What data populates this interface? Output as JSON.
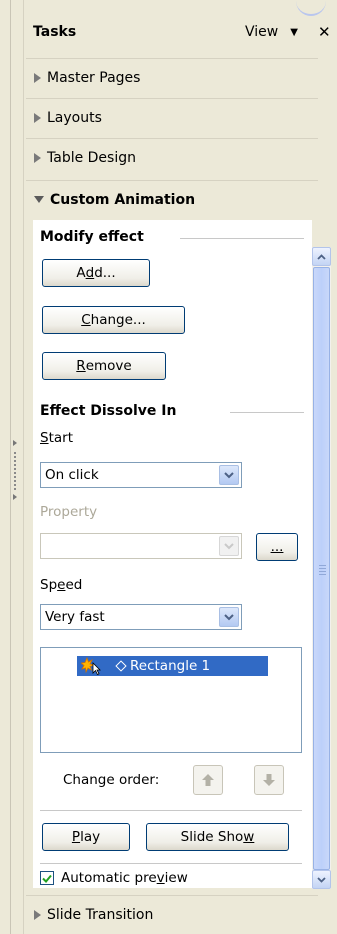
{
  "header": {
    "title": "Tasks",
    "view_label": "View",
    "view_dropdown_glyph": "▼",
    "close_glyph": "✕"
  },
  "decks": {
    "master_pages": "Master Pages",
    "layouts": "Layouts",
    "table_design": "Table Design",
    "custom_animation": "Custom Animation",
    "slide_transition": "Slide Transition"
  },
  "modify_effect": {
    "title": "Modify effect",
    "add_pre": "A",
    "add_key": "d",
    "add_post": "d...",
    "change_pre": "",
    "change_key": "C",
    "change_post": "hange...",
    "remove_pre": "",
    "remove_key": "R",
    "remove_post": "emove"
  },
  "effect": {
    "title": "Effect Dissolve In",
    "start_label_key": "S",
    "start_label_rest": "tart",
    "start_value": "On click",
    "property_label": "Property",
    "property_value": "",
    "property_more_pre": "",
    "property_more_key": "...",
    "speed_label_pre": "Sp",
    "speed_label_key": "e",
    "speed_label_post": "ed",
    "speed_value": "Very fast",
    "list_items": [
      {
        "label": "Rectangle 1"
      }
    ],
    "change_order_label": "Change order:"
  },
  "playback": {
    "play_pre": "",
    "play_key": "P",
    "play_post": "lay",
    "slideshow_pre": "Slide Sho",
    "slideshow_key": "w",
    "slideshow_post": "",
    "auto_preview_pre": "Automatic pre",
    "auto_preview_key": "v",
    "auto_preview_post": "iew",
    "auto_preview_checked": true
  },
  "colors": {
    "accent_border": "#003c74",
    "selection": "#316ac5",
    "check": "#21a121"
  },
  "icons": {
    "deck_collapsed": "triangle-right-icon",
    "deck_expanded": "triangle-down-icon",
    "move_up": "arrow-up-icon",
    "move_down": "arrow-down-icon",
    "effect_start": "mouse-click-star-icon",
    "effect_entry": "diamond-icon"
  }
}
